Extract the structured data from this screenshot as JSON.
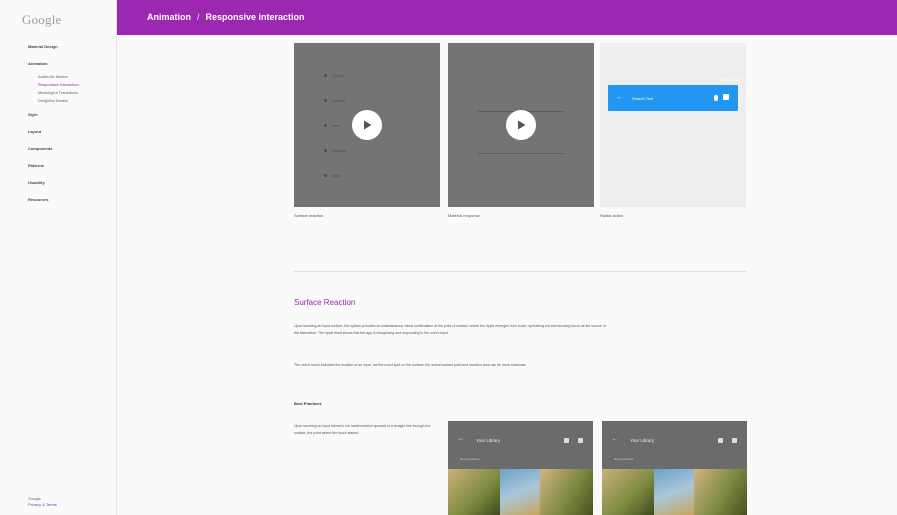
{
  "app": {
    "logo": "Google"
  },
  "sidebar": {
    "items": [
      {
        "label": "Material Design",
        "type": "top"
      },
      {
        "label": "Animation",
        "type": "top"
      },
      {
        "label": "Authentic Motion",
        "type": "sub"
      },
      {
        "label": "Responsive Interaction",
        "type": "sub",
        "active": true
      },
      {
        "label": "Meaningful Transitions",
        "type": "sub"
      },
      {
        "label": "Delightful Details",
        "type": "sub"
      },
      {
        "label": "Style",
        "type": "top"
      },
      {
        "label": "Layout",
        "type": "top"
      },
      {
        "label": "Components",
        "type": "top"
      },
      {
        "label": "Patterns",
        "type": "top"
      },
      {
        "label": "Usability",
        "type": "top"
      },
      {
        "label": "Resources",
        "type": "top"
      }
    ],
    "footer": {
      "line1": "Google",
      "line2": "Privacy & Terms"
    }
  },
  "header": {
    "section": "Animation",
    "separator": "/",
    "page": "Responsive interaction"
  },
  "tiles": {
    "t1_caption": "Surface reaction",
    "t2_caption": "Material response",
    "t3_caption": "Radial action",
    "t1_list": [
      "Option",
      "Default",
      "Item",
      "Settings",
      "Help"
    ],
    "search_label": "Search Text",
    "status": "▼ ▮ 12:30"
  },
  "section": {
    "title": "Surface Reaction",
    "p1": "Upon touching an input surface, the system provides an instantaneous visual confirmation at the point of contact, where the ripple emerges from touch, spreading out and showing touch as the source of the interaction. The ripple itself shows that the app is recognizing and responding to the user's input.",
    "p2": "The user's touch indicates the location of an input, not the exact spot on the surface; the actual contact point and reaction area can be more elaborate.",
    "subhead": "Best Practices",
    "p3": "Upon touching an input element, ink radial reaction spreads in a straight line through the surface, the point where the touch started."
  },
  "screens": {
    "s1_title": "Your Library",
    "s2_title": "Your Library",
    "sub": "Recent photos",
    "back": "←"
  }
}
